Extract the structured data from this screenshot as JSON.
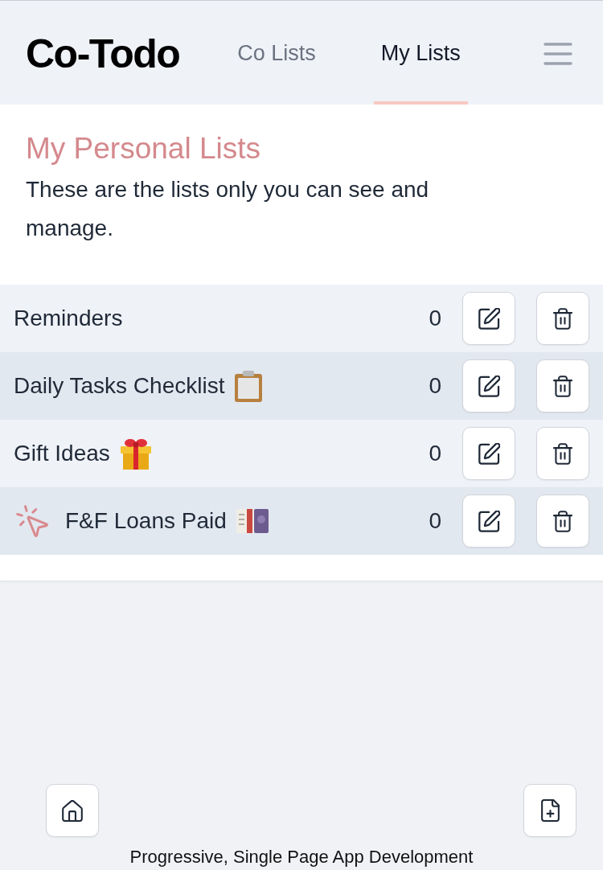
{
  "header": {
    "logo": "Co-Todo",
    "tabs": [
      {
        "label": "Co Lists",
        "selected": false
      },
      {
        "label": "My Lists",
        "selected": true
      }
    ]
  },
  "intro": {
    "title": "My Personal Lists",
    "description": "These are the lists only you can see and manage."
  },
  "lists": [
    {
      "name": "Reminders",
      "kind": "plain",
      "count": "0",
      "selected": false
    },
    {
      "name": "Daily Tasks Checklist",
      "kind": "clipboard",
      "count": "0",
      "selected": false
    },
    {
      "name": "Gift Ideas",
      "kind": "gift",
      "count": "0",
      "selected": false
    },
    {
      "name": "F&F Loans Paid",
      "kind": "pound-note",
      "count": "0",
      "selected": true
    }
  ],
  "footer": {
    "text": "Progressive, Single Page App Development"
  }
}
